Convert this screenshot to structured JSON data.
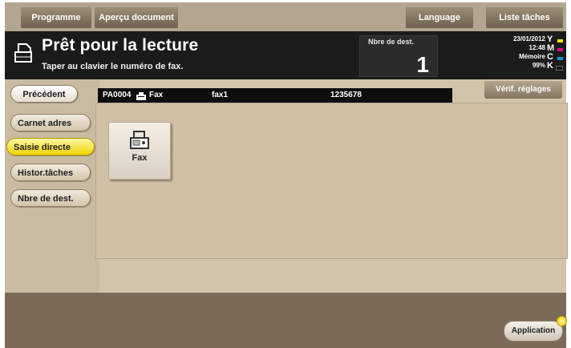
{
  "top_tabs": {
    "programme": "Programme",
    "apercu": "Aperçu document",
    "language": "Language",
    "liste_taches": "Liste tâches"
  },
  "header": {
    "title": "Prêt pour la lecture",
    "subtitle": "Taper au clavier le numéro de fax.",
    "dest_label": "Nbre de dest.",
    "dest_count": "1"
  },
  "status": {
    "date": "23/01/2012",
    "time": "12:48",
    "memory_label": "Mémoire",
    "memory_value": "99%",
    "toner": [
      {
        "letter": "Y",
        "color": "#f1e100"
      },
      {
        "letter": "M",
        "color": "#e0007d"
      },
      {
        "letter": "C",
        "color": "#0097d6"
      },
      {
        "letter": "K",
        "color": "#111111"
      }
    ]
  },
  "left_menu": {
    "precedent": "Précédent",
    "items": [
      {
        "label": "Carnet adres",
        "active": false
      },
      {
        "label": "Saisie directe",
        "active": true
      },
      {
        "label": "Histor.tâches",
        "active": false
      },
      {
        "label": "Nbre de dest.",
        "active": false
      }
    ]
  },
  "dest_row": {
    "id": "PA0004",
    "icon": "fax-icon",
    "type": "Fax",
    "name": "fax1",
    "number": "1235678"
  },
  "verif_label": "Vérif. réglages",
  "fax_button": {
    "label": "Fax"
  },
  "application_label": "Application",
  "colors": {
    "active_item": "#f1d300",
    "panel": "#d2c4aa",
    "header": "#1b1b1b"
  }
}
